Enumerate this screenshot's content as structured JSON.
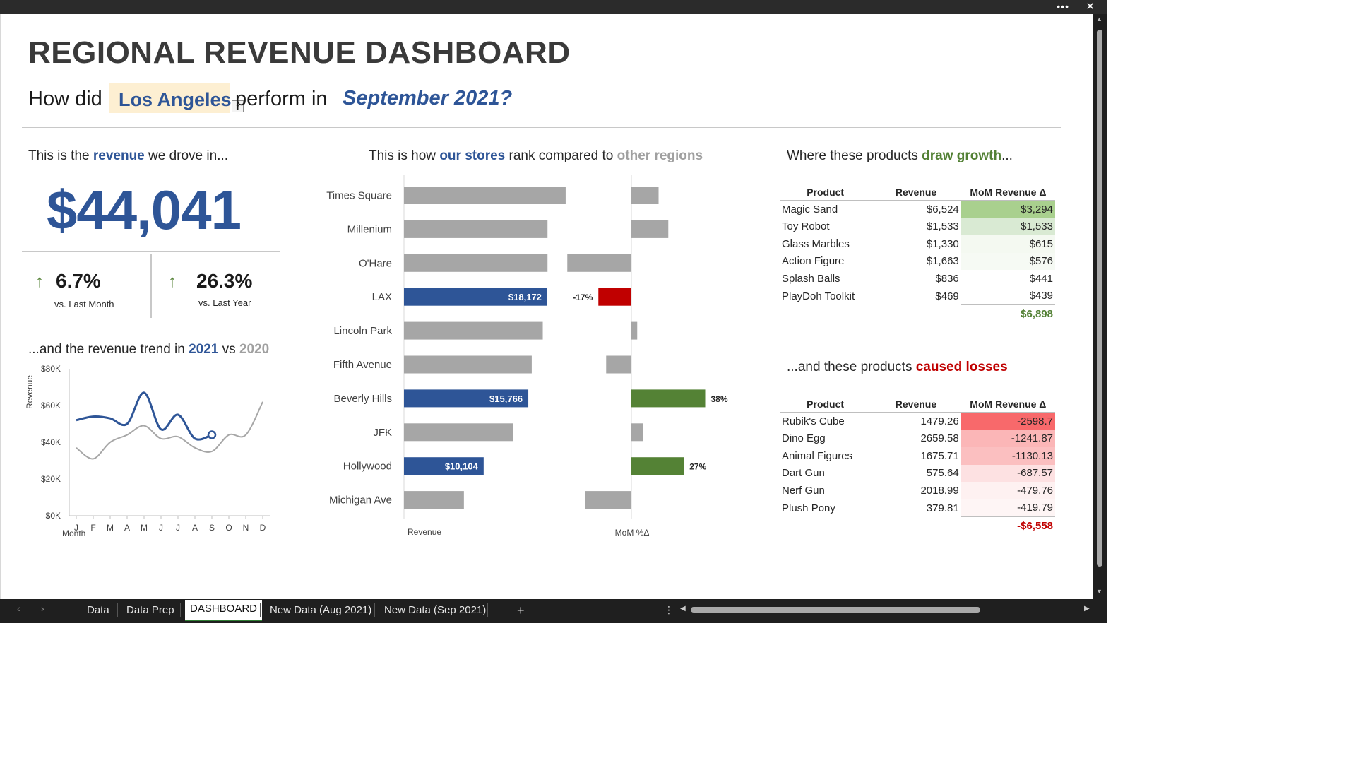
{
  "window": {
    "more_icon": "ellipsis-icon",
    "close_icon": "close-icon"
  },
  "header": {
    "title": "REGIONAL REVENUE DASHBOARD",
    "q_prefix": "How did",
    "city": "Los Angeles",
    "q_mid": "perform in",
    "month": "September 2021?"
  },
  "revenue": {
    "hdr_a": "This is the ",
    "hdr_b": "revenue",
    "hdr_c": " we drove in...",
    "amount": "$44,041",
    "mom_pct": "6.7%",
    "mom_label": "vs. Last Month",
    "yoy_pct": "26.3%",
    "yoy_label": "vs. Last Year"
  },
  "trend": {
    "hdr_a": "...and the revenue trend in ",
    "hdr_b": "2021",
    "hdr_c": " vs ",
    "hdr_d": "2020"
  },
  "chart_data": [
    {
      "type": "line",
      "ylabel": "Revenue",
      "xlabel": "Month",
      "categories": [
        "J",
        "F",
        "M",
        "A",
        "M",
        "J",
        "J",
        "A",
        "S",
        "O",
        "N",
        "D"
      ],
      "yticks": [
        "$0K",
        "$20K",
        "$40K",
        "$60K",
        "$80K"
      ],
      "ylim": [
        0,
        80000
      ],
      "series": [
        {
          "name": "2021",
          "color": "#2e5597",
          "values": [
            52000,
            54000,
            53000,
            50000,
            67000,
            47000,
            55000,
            42000,
            44041,
            null,
            null,
            null
          ]
        },
        {
          "name": "2020",
          "color": "#a6a6a6",
          "values": [
            37000,
            31000,
            40000,
            44000,
            49000,
            42000,
            43000,
            37000,
            35000,
            44000,
            44000,
            62000
          ]
        }
      ]
    },
    {
      "type": "bar",
      "orientation": "horizontal",
      "xlabel": "Revenue",
      "categories": [
        "Times Square",
        "Millenium",
        "O'Hare",
        "LAX",
        "Lincoln Park",
        "Fifth Avenue",
        "Beverly Hills",
        "JFK",
        "Hollywood",
        "Michigan Ave"
      ],
      "values": [
        20500,
        18200,
        18200,
        18172,
        17600,
        16200,
        15766,
        13800,
        10104,
        7600
      ],
      "highlight": [
        false,
        false,
        false,
        true,
        false,
        false,
        true,
        false,
        true,
        false
      ],
      "labels": [
        "",
        "",
        "",
        "$18,172",
        "",
        "",
        "$15,766",
        "",
        "$10,104",
        ""
      ],
      "colors": {
        "highlight": "#2e5597",
        "other": "#a6a6a6"
      }
    },
    {
      "type": "bar",
      "orientation": "horizontal",
      "xlabel": "MoM %Δ",
      "categories": [
        "Times Square",
        "Millenium",
        "O'Hare",
        "LAX",
        "Lincoln Park",
        "Fifth Avenue",
        "Beverly Hills",
        "JFK",
        "Hollywood",
        "Michigan Ave"
      ],
      "values": [
        14,
        19,
        -33,
        -17,
        3,
        -13,
        38,
        6,
        27,
        -24
      ],
      "labels": [
        "",
        "",
        "",
        "-17%",
        "",
        "",
        "38%",
        "",
        "27%",
        ""
      ],
      "colors": {
        "LAX": "#c00000",
        "Beverly Hills": "#548235",
        "Hollywood": "#548235",
        "other": "#a6a6a6"
      }
    }
  ],
  "stores": {
    "hdr_a": "This is how ",
    "hdr_b": "our stores",
    "hdr_c": " rank compared to ",
    "hdr_d": "other regions"
  },
  "growth": {
    "hdr_a": "Where these products ",
    "hdr_b": "draw growth",
    "hdr_c": "...",
    "columns": [
      "Product",
      "Revenue",
      "MoM Revenue Δ"
    ],
    "rows": [
      {
        "product": "Magic Sand",
        "revenue": "$6,524",
        "delta": "$3,294",
        "shade": "#a9d08e"
      },
      {
        "product": "Toy Robot",
        "revenue": "$1,533",
        "delta": "$1,533",
        "shade": "#d9ead3"
      },
      {
        "product": "Glass Marbles",
        "revenue": "$1,330",
        "delta": "$615",
        "shade": "#f4f9f1"
      },
      {
        "product": "Action Figure",
        "revenue": "$1,663",
        "delta": "$576",
        "shade": "#f6faf4"
      },
      {
        "product": "Splash Balls",
        "revenue": "$836",
        "delta": "$441",
        "shade": "#ffffff"
      },
      {
        "product": "PlayDoh Toolkit",
        "revenue": "$469",
        "delta": "$439",
        "shade": "#ffffff"
      }
    ],
    "total": "$6,898"
  },
  "losses": {
    "hdr_a": "...and these products ",
    "hdr_b": "caused losses",
    "columns": [
      "Product",
      "Revenue",
      "MoM Revenue Δ"
    ],
    "rows": [
      {
        "product": "Rubik's Cube",
        "revenue": "1479.26",
        "delta": "-2598.7",
        "shade": "#f8696b"
      },
      {
        "product": "Dino Egg",
        "revenue": "2659.58",
        "delta": "-1241.87",
        "shade": "#fbb6b7"
      },
      {
        "product": "Animal Figures",
        "revenue": "1675.71",
        "delta": "-1130.13",
        "shade": "#fbbfc0"
      },
      {
        "product": "Dart Gun",
        "revenue": "575.64",
        "delta": "-687.57",
        "shade": "#fde1e2"
      },
      {
        "product": "Nerf Gun",
        "revenue": "2018.99",
        "delta": "-479.76",
        "shade": "#fef1f1"
      },
      {
        "product": "Plush Pony",
        "revenue": "379.81",
        "delta": "-419.79",
        "shade": "#fef5f5"
      }
    ],
    "total": "-$6,558"
  },
  "tabs": {
    "items": [
      "Data",
      "Data Prep",
      "DASHBOARD",
      "New Data (Aug 2021)",
      "New Data (Sep 2021)"
    ],
    "active": "DASHBOARD",
    "add": "+",
    "prev_icon": "chevron-left-icon",
    "next_icon": "chevron-right-icon"
  }
}
